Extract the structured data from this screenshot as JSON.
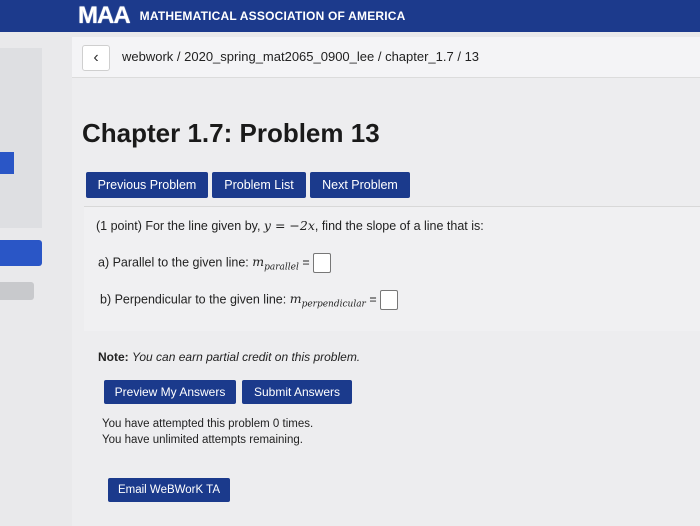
{
  "header": {
    "logo_mark": "MAA",
    "org_name": "MATHEMATICAL ASSOCIATION OF AMERICA",
    "brand_color": "#1c3a8c"
  },
  "breadcrumb": {
    "back_icon": "chevron-left-icon",
    "path": "webwork / 2020_spring_mat2065_0900_lee / chapter_1.7 / 13"
  },
  "page": {
    "title": "Chapter 1.7: Problem 13"
  },
  "nav": {
    "previous": "Previous Problem",
    "list": "Problem List",
    "next": "Next Problem"
  },
  "problem": {
    "intro_prefix": "(1 point) For the line given by, ",
    "equation": "y = −2x",
    "intro_suffix": ", find the slope of a line that is:",
    "part_a_label": "a) Parallel to the given line: ",
    "part_a_var": "m",
    "part_a_sub": "parallel",
    "part_b_label": "b) Perpendicular to the given line: ",
    "part_b_var": "m",
    "part_b_sub": "perpendicular",
    "equals": "=",
    "answer_a": "",
    "answer_b": ""
  },
  "note": {
    "label": "Note:",
    "text": "You can earn partial credit on this problem."
  },
  "actions": {
    "preview": "Preview My Answers",
    "submit": "Submit Answers"
  },
  "attempts": {
    "line1": "You have attempted this problem 0 times.",
    "line2": "You have unlimited attempts remaining."
  },
  "footer": {
    "email": "Email WeBWorK TA"
  }
}
